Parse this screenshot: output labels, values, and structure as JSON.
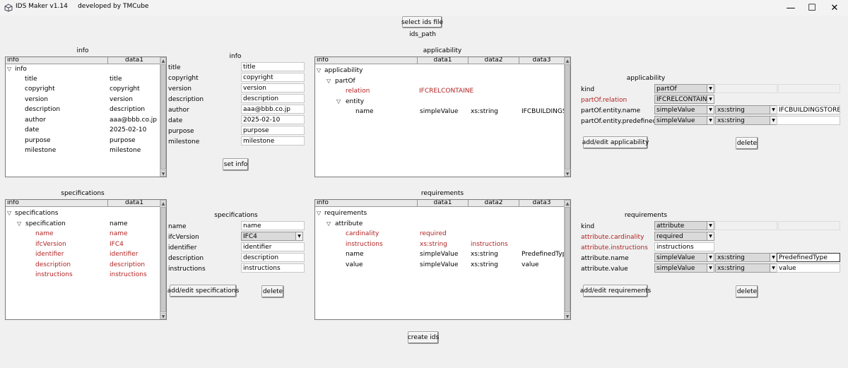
{
  "window": {
    "title": "IDS Maker v1.14     developed by TMCube",
    "minimize": "—",
    "maximize": "☐",
    "close": "✕"
  },
  "top": {
    "select_button": "select ids file",
    "ids_path": "ids_path",
    "create_button": "create ids"
  },
  "info": {
    "tree_label": "info",
    "columns": [
      "info",
      "data1"
    ],
    "root": "info",
    "rows": [
      {
        "key": "title",
        "value": "title"
      },
      {
        "key": "copyright",
        "value": "copyright"
      },
      {
        "key": "version",
        "value": "version"
      },
      {
        "key": "description",
        "value": "description"
      },
      {
        "key": "author",
        "value": "aaa@bbb.co.jp"
      },
      {
        "key": "date",
        "value": "2025-02-10"
      },
      {
        "key": "purpose",
        "value": "purpose"
      },
      {
        "key": "milestone",
        "value": "milestone"
      }
    ],
    "form_label": "info",
    "form": [
      {
        "label": "title",
        "value": "title"
      },
      {
        "label": "copyright",
        "value": "copyright"
      },
      {
        "label": "version",
        "value": "version"
      },
      {
        "label": "description",
        "value": "description"
      },
      {
        "label": "author",
        "value": "aaa@bbb.co.jp"
      },
      {
        "label": "date",
        "value": "2025-02-10"
      },
      {
        "label": "purpose",
        "value": "purpose"
      },
      {
        "label": "milestone",
        "value": "milestone"
      }
    ],
    "set_button": "set info"
  },
  "applicability": {
    "tree_label": "applicability",
    "columns": [
      "info",
      "data1",
      "data2",
      "data3"
    ],
    "root": "applicability",
    "partof": "partOf",
    "relation": {
      "key": "relation",
      "d1": "IFCRELCONTAINE"
    },
    "entity": "entity",
    "name_row": {
      "key": "name",
      "d1": "simpleValue",
      "d2": "xs:string",
      "d3": "IFCBUILDINGSTOF"
    },
    "form_label": "applicability",
    "kind_label": "kind",
    "kind_value": "partOf",
    "relation_label": "partOf.relation",
    "relation_value": "IFCRELCONTAINED",
    "ename_label": "partOf.entity.name",
    "ename_type": "simpleValue",
    "ename_base": "xs:string",
    "ename_value": "IFCBUILDINGSTOREY",
    "eptype_label": "partOf.entity.predefinedType",
    "eptype_type": "simpleValue",
    "eptype_base": "xs:string",
    "add_button": "add/edit applicability",
    "delete_button": "delete"
  },
  "specifications": {
    "tree_label": "specifications",
    "columns": [
      "info",
      "data1"
    ],
    "root": "specifications",
    "spec": {
      "key": "specification",
      "value": "name"
    },
    "rows": [
      {
        "key": "name",
        "value": "name"
      },
      {
        "key": "ifcVersion",
        "value": "IFC4"
      },
      {
        "key": "identifier",
        "value": "identifier"
      },
      {
        "key": "description",
        "value": "description"
      },
      {
        "key": "instructions",
        "value": "instructions"
      }
    ],
    "form_label": "specifications",
    "form": {
      "name_label": "name",
      "name_value": "name",
      "ifc_label": "ifcVersion",
      "ifc_value": "IFC4",
      "id_label": "identifier",
      "id_value": "identifier",
      "desc_label": "description",
      "desc_value": "description",
      "instr_label": "instructions",
      "instr_value": "instructions"
    },
    "add_button": "add/edit specifications",
    "delete_button": "delete"
  },
  "requirements": {
    "tree_label": "requirements",
    "columns": [
      "info",
      "data1",
      "data2",
      "data3"
    ],
    "root": "requirements",
    "attribute": "attribute",
    "rows": [
      {
        "key": "cardinality",
        "d1": "required",
        "d2": "",
        "d3": ""
      },
      {
        "key": "instructions",
        "d1": "xs:string",
        "d2": "instructions",
        "d3": ""
      },
      {
        "key": "name",
        "d1": "simpleValue",
        "d2": "xs:string",
        "d3": "PredefinedType"
      },
      {
        "key": "value",
        "d1": "simpleValue",
        "d2": "xs:string",
        "d3": "value"
      }
    ],
    "form_label": "requirements",
    "kind_label": "kind",
    "kind_value": "attribute",
    "card_label": "attribute.cardinality",
    "card_value": "required",
    "instr_label": "attribute.instructions",
    "instr_value": "instructions",
    "aname_label": "attribute.name",
    "aname_type": "simpleValue",
    "aname_base": "xs:string",
    "aname_value": "PredefinedType",
    "aval_label": "attribute.value",
    "aval_type": "simpleValue",
    "aval_base": "xs:string",
    "aval_value": "value",
    "add_button": "add/edit requirements",
    "delete_button": "delete"
  },
  "colors": {
    "required_field": "#b22222",
    "window_bg": "#f0f0f0"
  }
}
